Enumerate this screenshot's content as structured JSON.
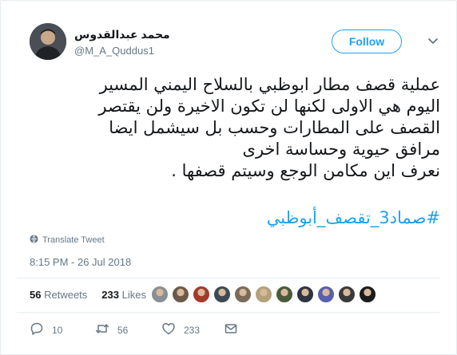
{
  "user": {
    "name": "محمد عبدالقدوس",
    "handle": "@M_A_Quddus1"
  },
  "follow_label": "Follow",
  "tweet": {
    "lines": [
      "عملية قصف مطار ابوظبي بالسلاح اليمني المسير",
      "اليوم هي الاولى لكنها لن تكون الاخيرة ولن يقتصر",
      "القصف على المطارات وحسب بل سيشمل ايضا",
      "مرافق حيوية وحساسة اخرى",
      "نعرف اين مكامن الوجع وسيتم قصفها ."
    ],
    "hashtag": "#صماد3_تقصف_أبوظبي"
  },
  "translate_label": "Translate Tweet",
  "timestamp": "8:15 PM - 26 Jul 2018",
  "stats": {
    "retweets_count": "56",
    "retweets_label": "Retweets",
    "likes_count": "233",
    "likes_label": "Likes"
  },
  "actions": {
    "reply_count": "10",
    "retweet_count": "56",
    "like_count": "233"
  },
  "colors": {
    "accent": "#1da1f2",
    "secondary_text": "#657786",
    "divider": "#e6ecf0"
  },
  "liker_avatar_colors": [
    "#8a8f94",
    "#6b5a4a",
    "#a23b2c",
    "#3d4a55",
    "#7a6a58",
    "#b4a07a",
    "#4a5a3a",
    "#2e3440",
    "#5a5fb0",
    "#3a3a3a",
    "#1c1c1c"
  ]
}
